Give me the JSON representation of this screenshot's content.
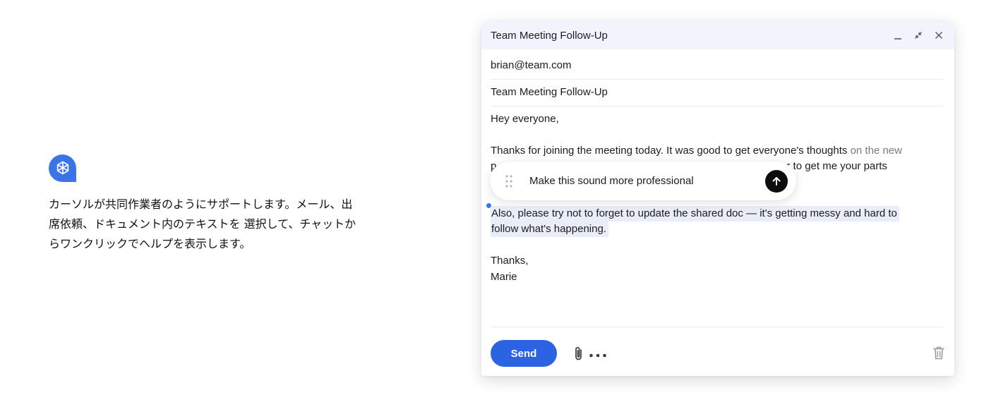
{
  "promo": {
    "logo_icon": "openai-logo-icon",
    "brand_color": "#3b74e6",
    "description": "カーソルが共同作業者のようにサポートします。メール、出席依頼、ドキュメント内のテキストを 選択して、チャットからワンクリックでヘルプを表示します。"
  },
  "compose": {
    "title": "Team Meeting Follow-Up",
    "controls": [
      "minimize-icon",
      "collapse-icon",
      "close-icon"
    ],
    "to": "brian@team.com",
    "subject": "Team Meeting Follow-Up",
    "body": {
      "greeting": "Hey everyone,",
      "para1_visible": "Thanks for joining the meeting today. It was good to get everyone's thoughts",
      "para1_faded": " on the new",
      "para1_line2_start": "p",
      "para1_line2_end": "nber to get me your parts",
      "para2": "Also, please try not to forget to update the shared doc — it's getting messy and hard to follow what's happening.",
      "signoff": "Thanks,",
      "name": "Marie"
    },
    "prompt": {
      "text": "Make this sound more professional",
      "send_icon": "arrow-up-icon"
    },
    "footer": {
      "send_label": "Send",
      "attach_icon": "paperclip-icon",
      "more_icon": "more-horizontal-icon",
      "delete_icon": "trash-icon"
    },
    "colors": {
      "accent": "#2c63e3",
      "header_bg": "#f1f4fc",
      "highlight": "#e9edf8"
    }
  }
}
